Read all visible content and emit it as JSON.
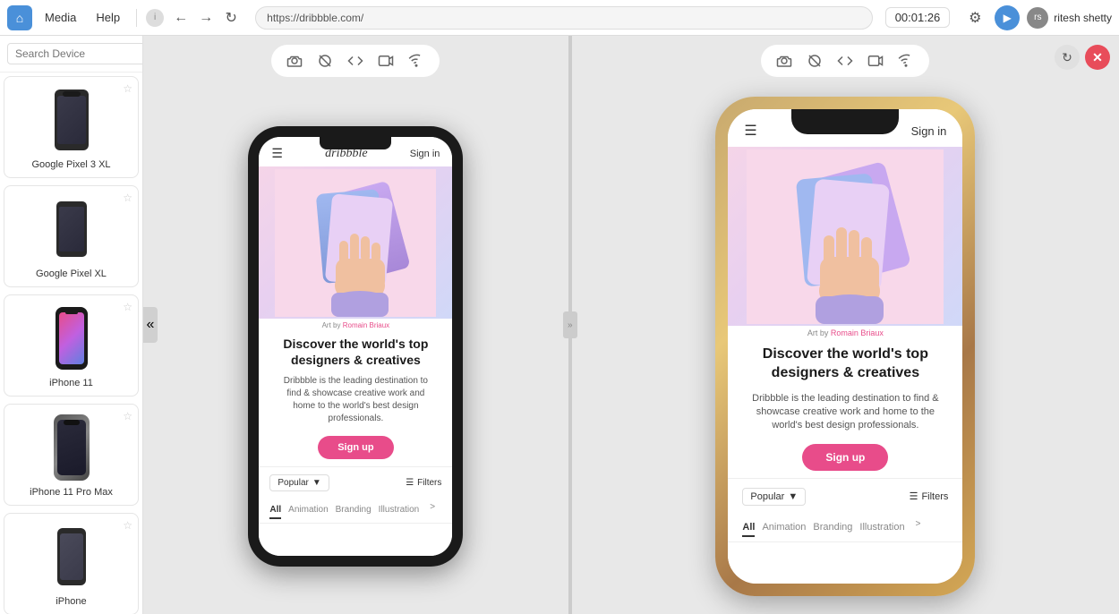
{
  "topbar": {
    "menu_items": [
      "Media",
      "Help"
    ],
    "url": "https://dribbble.com/",
    "timer": "00:01:26",
    "username": "ritesh shetty"
  },
  "sidebar": {
    "search_placeholder": "Search Device",
    "devices": [
      {
        "id": "google-pixel-3-xl",
        "name": "Google Pixel 3 XL",
        "starred": false
      },
      {
        "id": "google-pixel-xl",
        "name": "Google Pixel XL",
        "starred": false
      },
      {
        "id": "iphone-11",
        "name": "iPhone 11",
        "starred": false
      },
      {
        "id": "iphone-11-pro-max",
        "name": "iPhone 11 Pro Max",
        "starred": false
      },
      {
        "id": "iphone",
        "name": "iPhone",
        "starred": false
      }
    ]
  },
  "preview_left": {
    "device_name": "iPhone 11",
    "toolbar_icons": [
      "camera",
      "no-touch",
      "code",
      "record",
      "wifi"
    ]
  },
  "preview_right": {
    "device_name": "iPhone 11 Pro Max",
    "toolbar_icons": [
      "camera",
      "no-touch",
      "code",
      "record",
      "wifi"
    ]
  },
  "dribbble": {
    "logo": "dribbble",
    "signin": "Sign in",
    "art_credit": "Art by",
    "art_artist": "Romain Briaux",
    "headline": "Discover the world's top designers & creatives",
    "subtext": "Dribbble is the leading destination to find & showcase creative work and home to the world's best design professionals.",
    "signup_label": "Sign up",
    "popular_label": "Popular",
    "filters_label": "Filters",
    "tabs": [
      "All",
      "Animation",
      "Branding",
      "Illustration"
    ]
  }
}
